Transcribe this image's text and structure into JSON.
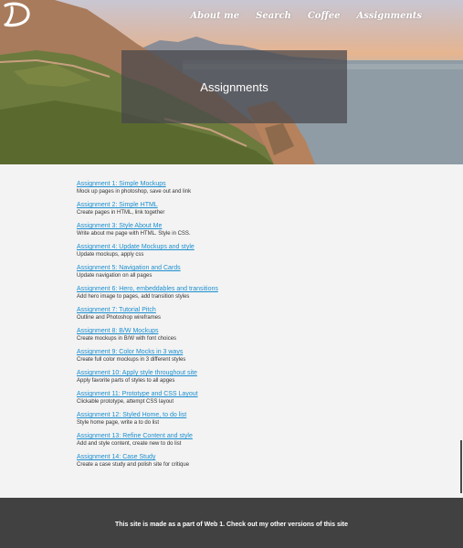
{
  "nav": {
    "items": [
      "About me",
      "Search",
      "Coffee",
      "Assignments"
    ]
  },
  "hero": {
    "title": "Assignments"
  },
  "assignments": [
    {
      "title": "Assignment 1: Simple Mockups",
      "desc": "Mock up pages in photoshop, save out and link"
    },
    {
      "title": "Assignment 2: Simple HTML",
      "desc": "Create pages in HTML, link together"
    },
    {
      "title": "Assignment 3: Style About Me",
      "desc": "Write about me page with HTML. Style in CSS."
    },
    {
      "title": "Assignment 4: Update Mockups and style",
      "desc": "Update mockups, apply css"
    },
    {
      "title": "Assignment 5: Navigation and Cards",
      "desc": "Update navigation on all pages"
    },
    {
      "title": "Assignment 6: Hero, embeddables and transitions",
      "desc": "Add hero image to pages, add transition styles"
    },
    {
      "title": "Assignment 7: Tutorial Pitch",
      "desc": "Outline and Photoshop wireframes"
    },
    {
      "title": "Assignment 8: B/W Mockups",
      "desc": "Create mockups in B/W with font choices"
    },
    {
      "title": "Assignment 9: Color Mocks in 3 ways",
      "desc": "Create full color mockups in 3 different styles"
    },
    {
      "title": "Assignment 10: Apply style throughout site",
      "desc": "Apply favorite parts of styles to all apges"
    },
    {
      "title": "Assignment 11: Prototype and CSS Layout",
      "desc": "Clickable prototype, attempt CSS layout"
    },
    {
      "title": "Assignment 12: Styled Home, to do list",
      "desc": "Style home page, write a to do list"
    },
    {
      "title": "Assignment 13: Refine Content and style",
      "desc": "Add and style content, create new to do list"
    },
    {
      "title": "Assignment 14: Case Study",
      "desc": "Create a case study and polish site for critique"
    }
  ],
  "footer": {
    "text": "This site is made as a part of Web 1. Check out my other versions of this site"
  },
  "colors": {
    "link": "#1c8fd0",
    "footer_bg": "#414141",
    "page_bg": "#f3f3f3",
    "title_box": "rgba(70,70,75,0.72)"
  }
}
